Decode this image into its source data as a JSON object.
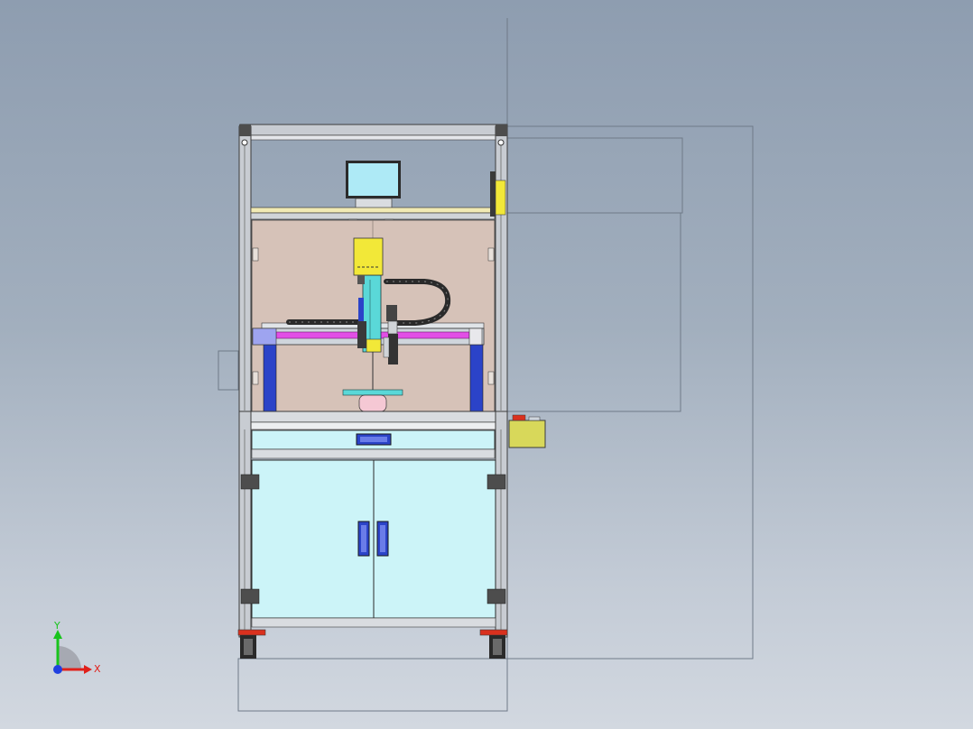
{
  "viewport": {
    "background_top": "#8e9db0",
    "background_bottom": "#d2d8e0"
  },
  "model": {
    "frame_color": "#c8ccd2",
    "frame_edge": "#3c3c3c",
    "panel_color": "#d6c2b8",
    "door_color": "#ccf4f8",
    "handle_color": "#2b43c8",
    "camera_color": "#f2e838",
    "rail_color": "#e24ee6",
    "axis_color": "#5ad8d8",
    "monitor_color": "#aeeaf6",
    "caster_color": "#d9301e",
    "control_box_color": "#d8d85a"
  },
  "triad": {
    "x_label": "X",
    "y_label": "Y",
    "x_color": "#e0201a",
    "y_color": "#18c41c",
    "z_color": "#2040e0"
  }
}
